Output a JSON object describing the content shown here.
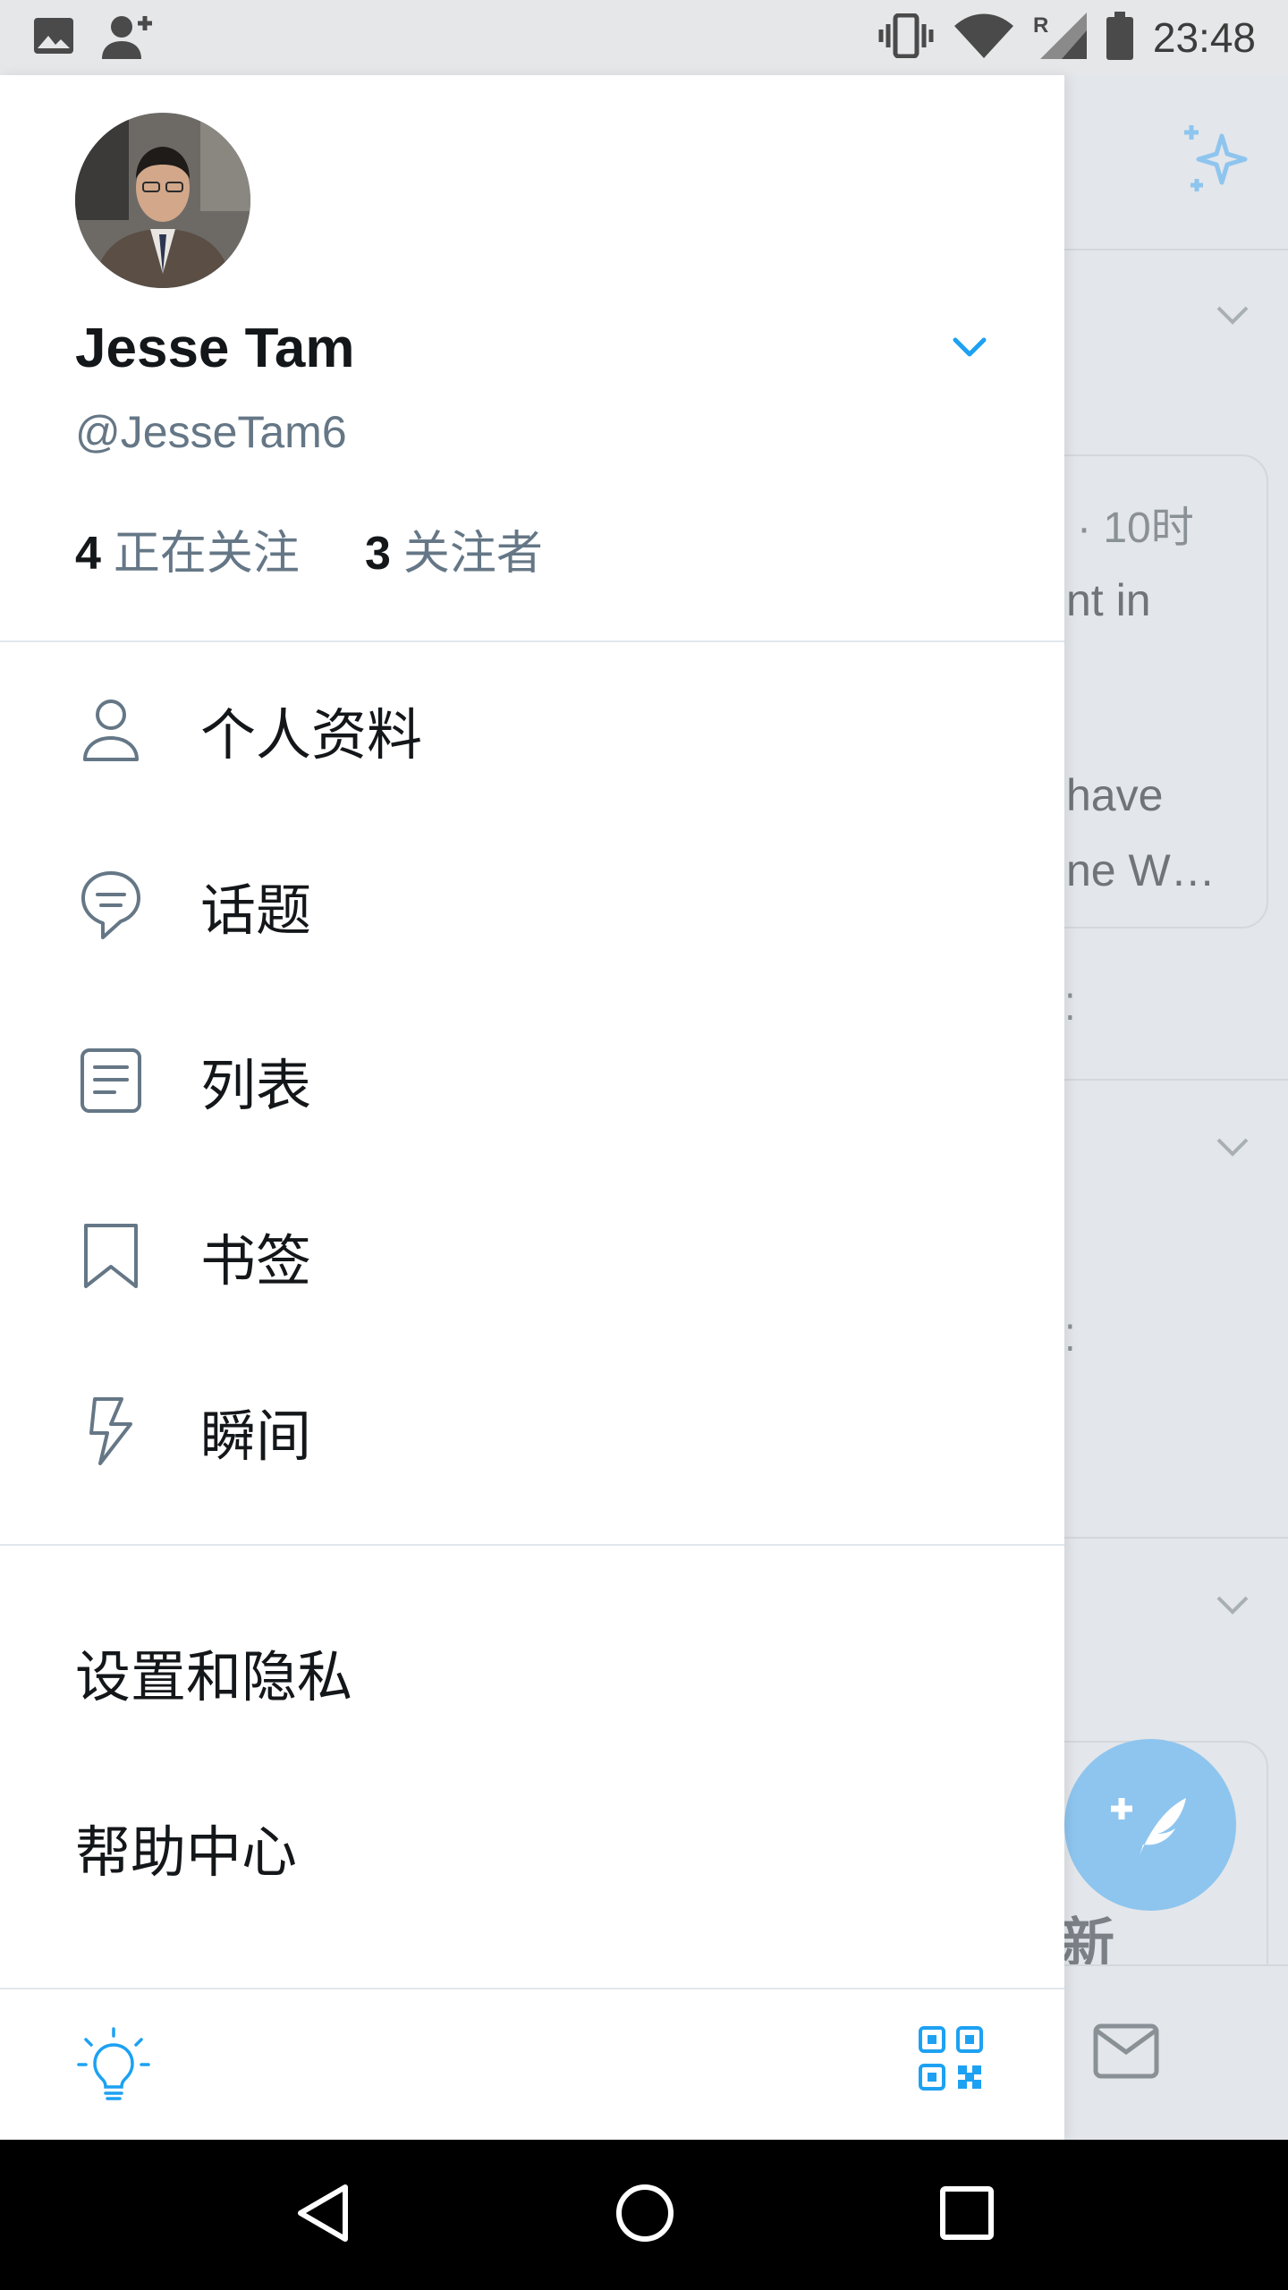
{
  "status_bar": {
    "time": "23:48",
    "icons": [
      "image-icon",
      "person-add-icon",
      "vibrate-icon",
      "wifi-icon",
      "roaming-signal-icon",
      "battery-icon"
    ],
    "roaming_indicator": "R"
  },
  "drawer": {
    "profile": {
      "name": "Jesse Tam",
      "handle": "@JesseTam6",
      "following_count": "4",
      "following_label": "正在关注",
      "followers_count": "3",
      "followers_label": "关注者"
    },
    "menu": {
      "profile": "个人资料",
      "topics": "话题",
      "lists": "列表",
      "bookmarks": "书签",
      "moments": "瞬间"
    },
    "secondary": {
      "settings": "设置和隐私",
      "help": "帮助中心"
    }
  },
  "background": {
    "tweet_meta": "· 10时",
    "tweet_line1": "nt in",
    "tweet_line2": "have",
    "tweet_line3": "ne W…",
    "partial_glyph": "新"
  },
  "colors": {
    "accent": "#1da1f2",
    "icon_gray": "#657786",
    "divider": "#e1e8ed"
  }
}
